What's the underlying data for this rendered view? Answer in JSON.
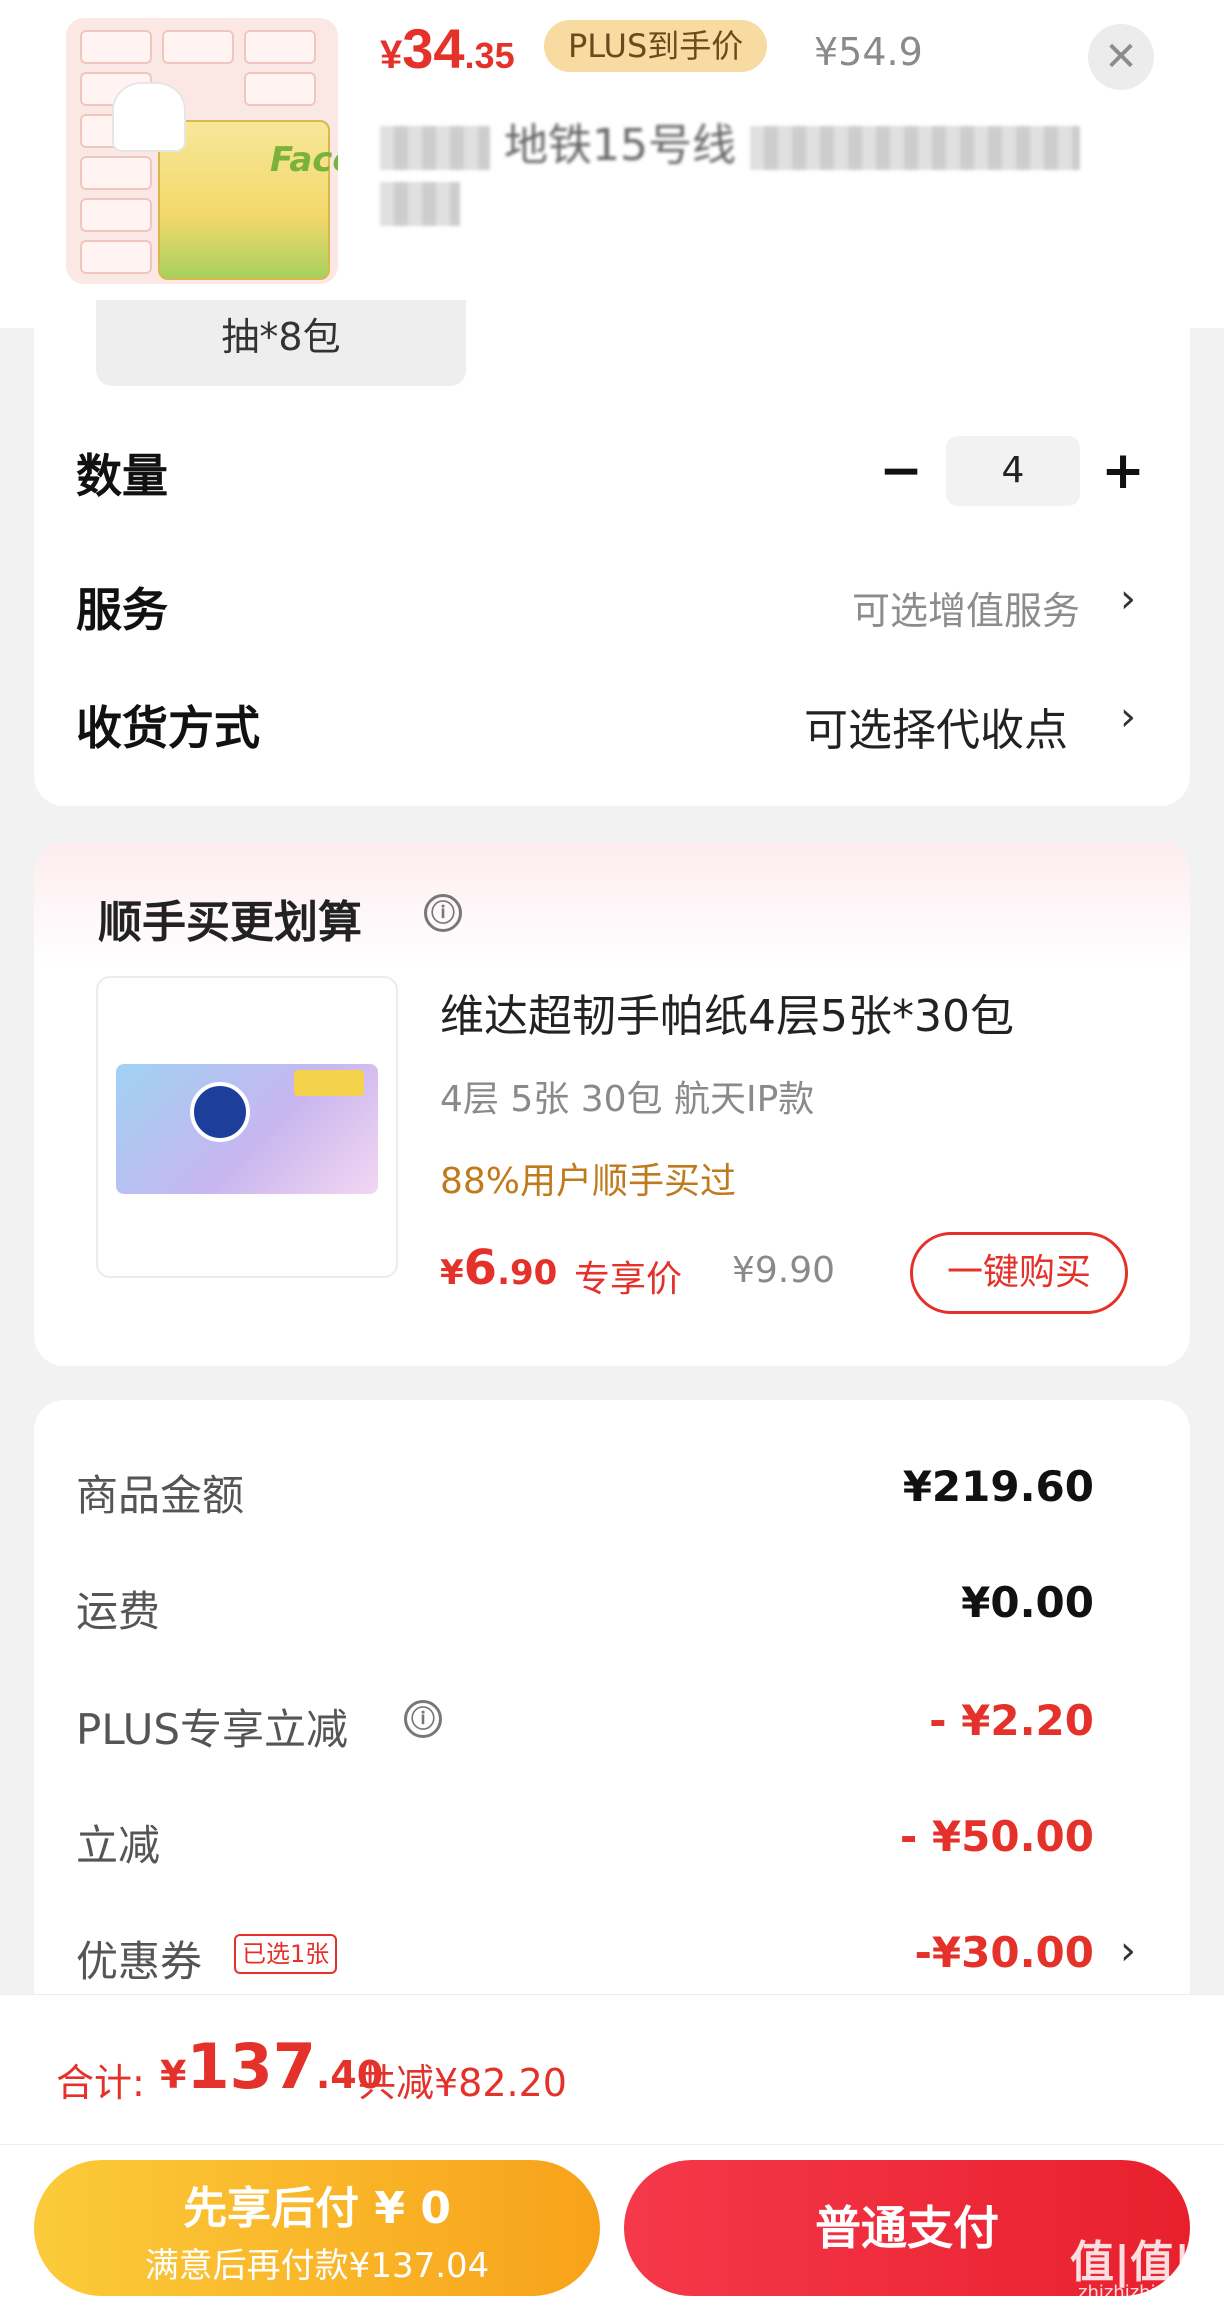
{
  "header": {
    "price": {
      "currency": "¥",
      "integer": "34",
      "decimal": ".35"
    },
    "plus_badge": "PLUS到手价",
    "original_price": "¥54.9",
    "close_icon": "close-icon",
    "title_visible_fragment": "地铁15号线"
  },
  "spec": {
    "selected_chip": "抽*8包"
  },
  "quantity": {
    "label": "数量",
    "minus": "−",
    "value": "4",
    "plus": "+"
  },
  "service": {
    "label": "服务",
    "value": "可选增值服务",
    "chevron": "›"
  },
  "delivery": {
    "label": "收货方式",
    "value": "可选择代收点",
    "chevron": "›"
  },
  "recommend": {
    "title": "顺手买更划算",
    "info_icon": "ⓘ",
    "product_name": "维达超韧手帕纸4层5张*30包",
    "spec": "4层 5张 30包 航天IP款",
    "stat": "88%用户顺手买过",
    "price": {
      "currency": "¥",
      "integer": "6",
      "decimal": ".90"
    },
    "price_label": "专享价",
    "original_price": "¥9.90",
    "buy_button": "一键购买"
  },
  "summary": {
    "rows": [
      {
        "label": "商品金额",
        "value": "¥219.60"
      },
      {
        "label": "运费",
        "value": "¥0.00"
      },
      {
        "label": "PLUS专享立减",
        "value": "- ¥2.20"
      },
      {
        "label": "立减",
        "value": "- ¥50.00"
      },
      {
        "label": "优惠券",
        "value": "-¥30.00"
      }
    ],
    "coupon_tag": "已选1张",
    "chevron": "›"
  },
  "totals": {
    "label": "合计:",
    "price": {
      "currency": "¥",
      "integer": "137",
      "decimal": ".40"
    },
    "saved": "共减¥82.20"
  },
  "actions": {
    "pay_later_line1": "先享后付 ¥ 0",
    "pay_later_line2": "满意后再付款¥137.04",
    "pay_normal": "普通支付"
  },
  "watermark": {
    "logo": "值|值|值",
    "site": "zhizhizhi.com"
  },
  "colors": {
    "accent_red": "#e4322b",
    "plus_gold": "#f7dba0",
    "pay_later_orange": "#f8a21a"
  }
}
